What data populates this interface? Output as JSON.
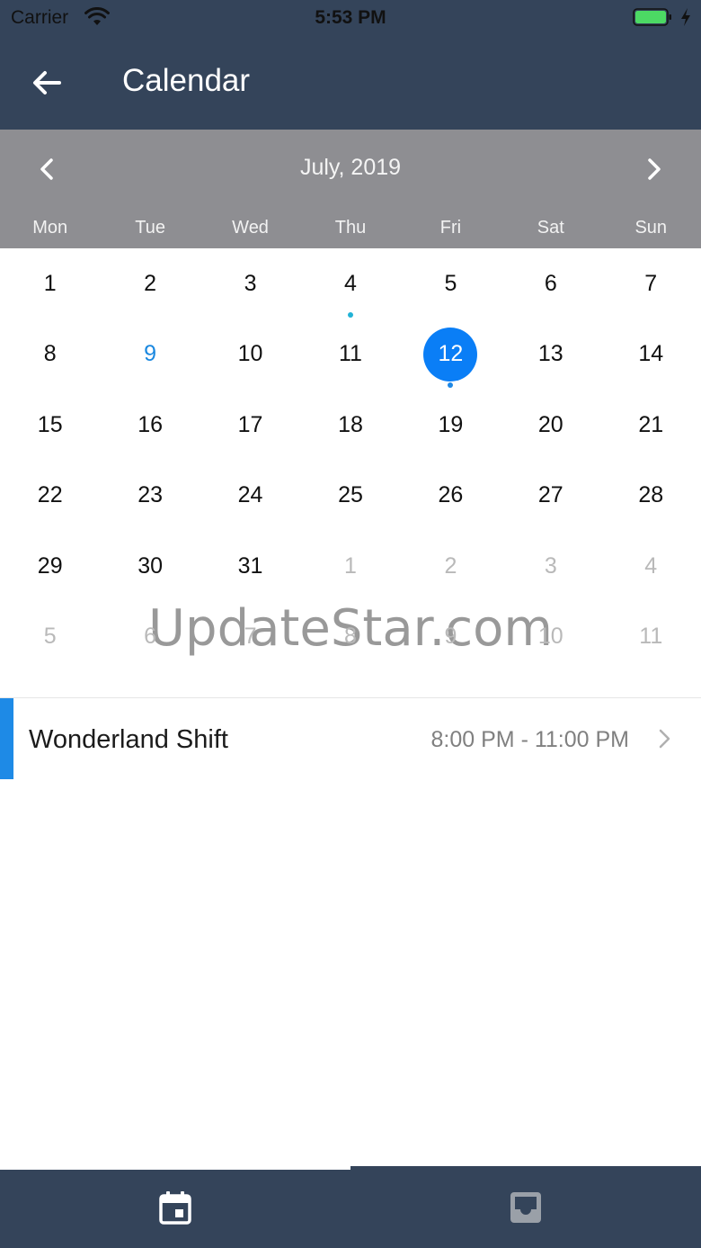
{
  "status_bar": {
    "carrier": "Carrier",
    "time": "5:53 PM"
  },
  "app_bar": {
    "title": "Calendar",
    "back_icon": "arrow-left-icon"
  },
  "calendar": {
    "month_label": "July, 2019",
    "weekdays": [
      "Mon",
      "Tue",
      "Wed",
      "Thu",
      "Fri",
      "Sat",
      "Sun"
    ],
    "weeks": [
      [
        {
          "d": "1"
        },
        {
          "d": "2"
        },
        {
          "d": "3"
        },
        {
          "d": "4",
          "dot": "#22b2d6"
        },
        {
          "d": "5"
        },
        {
          "d": "6"
        },
        {
          "d": "7"
        }
      ],
      [
        {
          "d": "8"
        },
        {
          "d": "9",
          "accent": true
        },
        {
          "d": "10"
        },
        {
          "d": "11"
        },
        {
          "d": "12",
          "selected": true,
          "dot": "#1e88e5"
        },
        {
          "d": "13"
        },
        {
          "d": "14"
        }
      ],
      [
        {
          "d": "15"
        },
        {
          "d": "16"
        },
        {
          "d": "17"
        },
        {
          "d": "18"
        },
        {
          "d": "19"
        },
        {
          "d": "20"
        },
        {
          "d": "21"
        }
      ],
      [
        {
          "d": "22"
        },
        {
          "d": "23"
        },
        {
          "d": "24"
        },
        {
          "d": "25"
        },
        {
          "d": "26"
        },
        {
          "d": "27"
        },
        {
          "d": "28"
        }
      ],
      [
        {
          "d": "29"
        },
        {
          "d": "30"
        },
        {
          "d": "31"
        },
        {
          "d": "1",
          "other": true
        },
        {
          "d": "2",
          "other": true
        },
        {
          "d": "3",
          "other": true
        },
        {
          "d": "4",
          "other": true
        }
      ],
      [
        {
          "d": "5",
          "other": true
        },
        {
          "d": "6",
          "other": true
        },
        {
          "d": "7",
          "other": true
        },
        {
          "d": "8",
          "other": true
        },
        {
          "d": "9",
          "other": true
        },
        {
          "d": "10",
          "other": true
        },
        {
          "d": "11",
          "other": true
        }
      ]
    ]
  },
  "watermark": "UpdateStar.com",
  "event": {
    "title": "Wonderland Shift",
    "time": "8:00 PM - 11:00 PM"
  },
  "tab_bar": {
    "tabs": [
      {
        "icon": "calendar-icon",
        "active": true
      },
      {
        "icon": "inbox-icon",
        "active": false
      }
    ]
  },
  "colors": {
    "header_bg": "#34445a",
    "calendar_header_bg": "#8e8e92",
    "selected_day": "#0a7ef6",
    "accent": "#1e8ae6"
  }
}
